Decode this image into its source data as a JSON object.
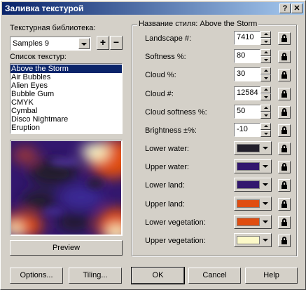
{
  "window": {
    "title": "Заливка текстурой",
    "help_label": "?",
    "close_label": "✕"
  },
  "library": {
    "label": "Текстурная библиотека:",
    "selected": "Samples 9",
    "add_label": "+",
    "remove_label": "−"
  },
  "texture_list": {
    "label": "Список текстур:",
    "items": [
      "Above the Storm",
      "Air Bubbles",
      "Alien Eyes",
      "Bubble Gum",
      "CMYK",
      "Cymbal",
      "Disco Nightmare",
      "Eruption"
    ],
    "selected_index": 0
  },
  "preview": {
    "button_label": "Preview",
    "colors": {
      "water": "#221f2b",
      "water_upper": "#32176e",
      "land": "#32176e",
      "land_upper": "#e04d10",
      "veg_lower": "#e04d10",
      "veg_upper": "#fcf9c8"
    }
  },
  "style_group": {
    "title": "Название стиля: Above the Storm",
    "params": [
      {
        "label": "Landscape #:",
        "value": "7410"
      },
      {
        "label": "Softness %:",
        "value": "80"
      },
      {
        "label": "Cloud %:",
        "value": "30"
      },
      {
        "label": "Cloud #:",
        "value": "12584"
      },
      {
        "label": "Cloud softness %:",
        "value": "50"
      },
      {
        "label": "Brightness ±%:",
        "value": "-10"
      }
    ],
    "colors": [
      {
        "label": "Lower water:",
        "color": "#221f2b"
      },
      {
        "label": "Upper water:",
        "color": "#32176e"
      },
      {
        "label": "Lower land:",
        "color": "#32176e"
      },
      {
        "label": "Upper land:",
        "color": "#e04d10"
      },
      {
        "label": "Lower vegetation:",
        "color": "#e04d10"
      },
      {
        "label": "Upper vegetation:",
        "color": "#fcf9c8"
      }
    ]
  },
  "footer": {
    "options_label": "Options...",
    "tiling_label": "Tiling...",
    "ok_label": "OK",
    "cancel_label": "Cancel",
    "help_label": "Help"
  }
}
